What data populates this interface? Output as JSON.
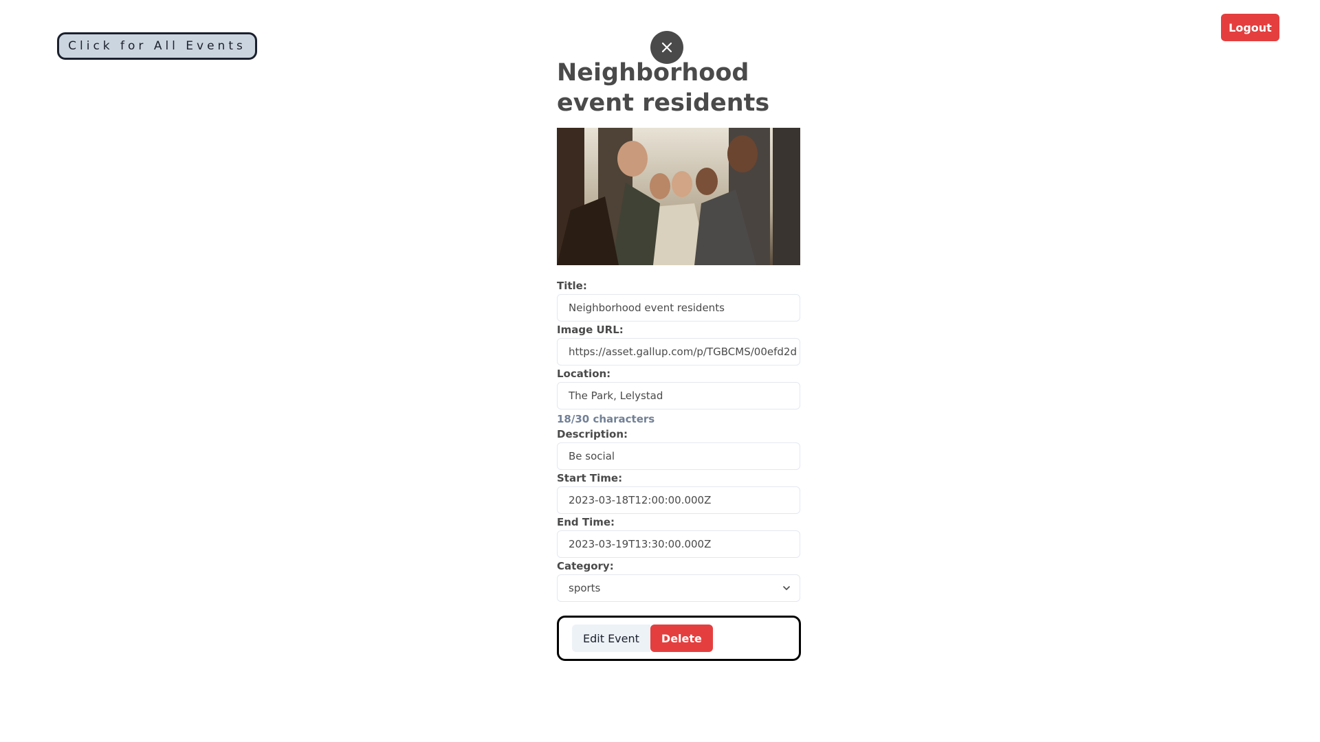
{
  "nav": {
    "all_events_label": "Click for All Events",
    "logout_label": "Logout"
  },
  "event": {
    "title": "Neighborhood event residents",
    "close_icon": "close-icon"
  },
  "form": {
    "title_label": "Title:",
    "title_value": "Neighborhood event residents",
    "image_url_label": "Image URL:",
    "image_url_value": "https://asset.gallup.com/p/TGBCMS/00efd2d",
    "location_label": "Location:",
    "location_value": "The Park, Lelystad",
    "location_char_count": "18/30 characters",
    "description_label": "Description:",
    "description_value": "Be social",
    "start_time_label": "Start Time:",
    "start_time_value": "2023-03-18T12:00:00.000Z",
    "end_time_label": "End Time:",
    "end_time_value": "2023-03-19T13:30:00.000Z",
    "category_label": "Category:",
    "category_selected": "sports"
  },
  "actions": {
    "edit_label": "Edit Event",
    "delete_label": "Delete"
  },
  "colors": {
    "danger": "#e53e3e",
    "nav_button_bg": "#cbd5e0",
    "text": "#4a4a4a"
  }
}
